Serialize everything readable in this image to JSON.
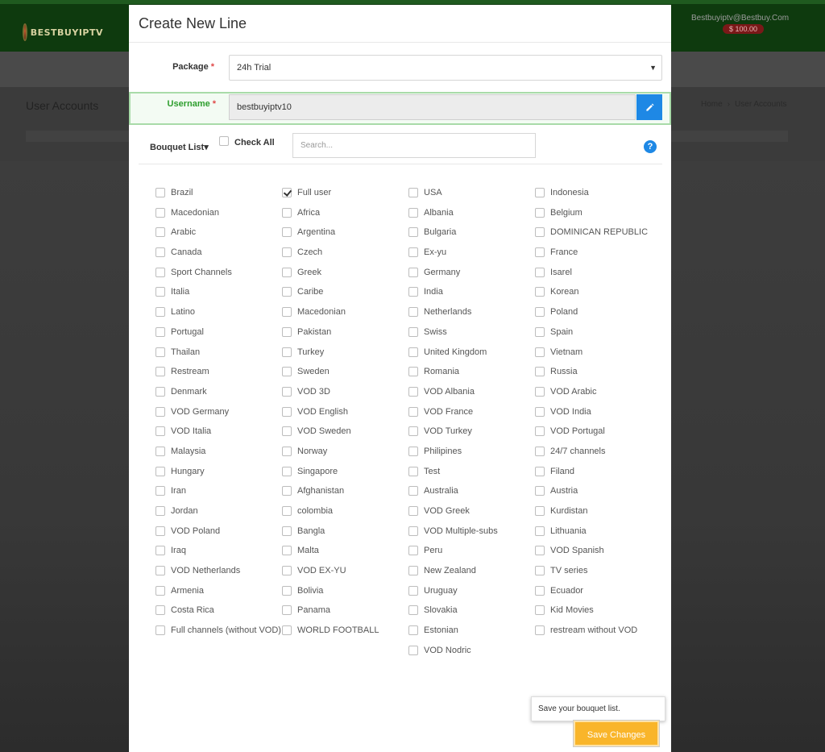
{
  "background_page": {
    "logo_text": "BESTBUYIPTV",
    "user_email": "Bestbuyiptv@Bestbuy.Com",
    "balance": "$ 100.00",
    "page_title": "User Accounts",
    "breadcrumb": [
      "Home",
      "User Accounts"
    ]
  },
  "modal": {
    "title": "Create New Line",
    "package": {
      "label": "Package",
      "required_mark": "*",
      "value": "24h Trial",
      "caret": "▼"
    },
    "username": {
      "label": "Username",
      "required_mark": "*",
      "value": "bestbuyiptv10",
      "icon": "pencil-icon"
    },
    "bouquet": {
      "toggle_label": "Bouquet List",
      "toggle_caret": "▾",
      "check_all_label": "Check All",
      "search_placeholder": "Search...",
      "help_symbol": "?"
    },
    "bouquet_items": [
      {
        "label": "Brazil",
        "checked": false
      },
      {
        "label": "Full user",
        "checked": true
      },
      {
        "label": "USA",
        "checked": false
      },
      {
        "label": "Indonesia",
        "checked": false
      },
      {
        "label": "Macedonian",
        "checked": false
      },
      {
        "label": "Africa",
        "checked": false
      },
      {
        "label": "Albania",
        "checked": false
      },
      {
        "label": "Belgium",
        "checked": false
      },
      {
        "label": "Arabic",
        "checked": false
      },
      {
        "label": "Argentina",
        "checked": false
      },
      {
        "label": "Bulgaria",
        "checked": false
      },
      {
        "label": "DOMINICAN REPUBLIC",
        "checked": false
      },
      {
        "label": "Canada",
        "checked": false
      },
      {
        "label": "Czech",
        "checked": false
      },
      {
        "label": "Ex-yu",
        "checked": false
      },
      {
        "label": "France",
        "checked": false
      },
      {
        "label": "Sport Channels",
        "checked": false
      },
      {
        "label": "Greek",
        "checked": false
      },
      {
        "label": "Germany",
        "checked": false
      },
      {
        "label": "Isarel",
        "checked": false
      },
      {
        "label": "Italia",
        "checked": false
      },
      {
        "label": "Caribe",
        "checked": false
      },
      {
        "label": "India",
        "checked": false
      },
      {
        "label": "Korean",
        "checked": false
      },
      {
        "label": "Latino",
        "checked": false
      },
      {
        "label": "Macedonian",
        "checked": false
      },
      {
        "label": "Netherlands",
        "checked": false
      },
      {
        "label": "Poland",
        "checked": false
      },
      {
        "label": "Portugal",
        "checked": false
      },
      {
        "label": "Pakistan",
        "checked": false
      },
      {
        "label": "Swiss",
        "checked": false
      },
      {
        "label": "Spain",
        "checked": false
      },
      {
        "label": "Thailan",
        "checked": false
      },
      {
        "label": "Turkey",
        "checked": false
      },
      {
        "label": "United Kingdom",
        "checked": false
      },
      {
        "label": "Vietnam",
        "checked": false
      },
      {
        "label": "Restream",
        "checked": false
      },
      {
        "label": "Sweden",
        "checked": false
      },
      {
        "label": "Romania",
        "checked": false
      },
      {
        "label": "Russia",
        "checked": false
      },
      {
        "label": "Denmark",
        "checked": false
      },
      {
        "label": "VOD 3D",
        "checked": false
      },
      {
        "label": "VOD Albania",
        "checked": false
      },
      {
        "label": "VOD Arabic",
        "checked": false
      },
      {
        "label": "VOD Germany",
        "checked": false
      },
      {
        "label": "VOD English",
        "checked": false
      },
      {
        "label": "VOD France",
        "checked": false
      },
      {
        "label": "VOD India",
        "checked": false
      },
      {
        "label": "VOD Italia",
        "checked": false
      },
      {
        "label": "VOD Sweden",
        "checked": false
      },
      {
        "label": "VOD Turkey",
        "checked": false
      },
      {
        "label": "VOD Portugal",
        "checked": false
      },
      {
        "label": "Malaysia",
        "checked": false
      },
      {
        "label": "Norway",
        "checked": false
      },
      {
        "label": "Philipines",
        "checked": false
      },
      {
        "label": "24/7 channels",
        "checked": false
      },
      {
        "label": "Hungary",
        "checked": false
      },
      {
        "label": "Singapore",
        "checked": false
      },
      {
        "label": "Test",
        "checked": false
      },
      {
        "label": "Filand",
        "checked": false
      },
      {
        "label": "Iran",
        "checked": false
      },
      {
        "label": "Afghanistan",
        "checked": false
      },
      {
        "label": "Australia",
        "checked": false
      },
      {
        "label": "Austria",
        "checked": false
      },
      {
        "label": "Jordan",
        "checked": false
      },
      {
        "label": "colombia",
        "checked": false
      },
      {
        "label": "VOD Greek",
        "checked": false
      },
      {
        "label": "Kurdistan",
        "checked": false
      },
      {
        "label": "VOD Poland",
        "checked": false
      },
      {
        "label": "Bangla",
        "checked": false
      },
      {
        "label": "VOD Multiple-subs",
        "checked": false
      },
      {
        "label": "Lithuania",
        "checked": false
      },
      {
        "label": "Iraq",
        "checked": false
      },
      {
        "label": "Malta",
        "checked": false
      },
      {
        "label": "Peru",
        "checked": false
      },
      {
        "label": "VOD Spanish",
        "checked": false
      },
      {
        "label": "VOD Netherlands",
        "checked": false
      },
      {
        "label": "VOD EX-YU",
        "checked": false
      },
      {
        "label": "New Zealand",
        "checked": false
      },
      {
        "label": "TV series",
        "checked": false
      },
      {
        "label": "Armenia",
        "checked": false
      },
      {
        "label": "Bolivia",
        "checked": false
      },
      {
        "label": "Uruguay",
        "checked": false
      },
      {
        "label": "Ecuador",
        "checked": false
      },
      {
        "label": "Costa Rica",
        "checked": false
      },
      {
        "label": "Panama",
        "checked": false
      },
      {
        "label": "Slovakia",
        "checked": false
      },
      {
        "label": "Kid Movies",
        "checked": false
      },
      {
        "label": "Full channels (without VOD)",
        "checked": false,
        "tall": true
      },
      {
        "label": "WORLD FOOTBALL",
        "checked": false
      },
      {
        "label": "Estonian",
        "checked": false
      },
      {
        "label": "restream without VOD",
        "checked": false
      },
      {
        "label": "",
        "checked": false,
        "spacer": true
      },
      {
        "label": "VOD Nodric",
        "checked": false
      }
    ],
    "tooltip_text": "Save your bouquet list.",
    "save_button_label": "Save Changes"
  }
}
